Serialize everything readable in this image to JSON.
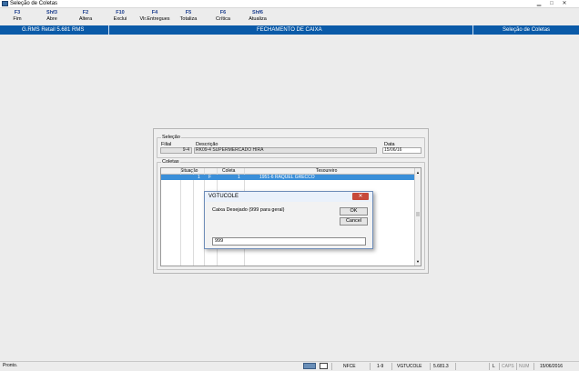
{
  "window": {
    "title": "Seleção de Coletas",
    "controls": [
      "▁",
      "□",
      "✕"
    ]
  },
  "toolbar": [
    {
      "key": "F3",
      "label": "Fim"
    },
    {
      "key": "Shf3",
      "label": "Abre"
    },
    {
      "key": "F2",
      "label": "Altera"
    },
    {
      "key": "F10",
      "label": "Exclui"
    },
    {
      "key": "F4",
      "label": "Vlr.Entregues"
    },
    {
      "key": "F5",
      "label": "Totaliza"
    },
    {
      "key": "F6",
      "label": "Crítica"
    },
    {
      "key": "Shf6",
      "label": "Atualiza"
    }
  ],
  "appbar": {
    "product": "G.RMS Retail 5.681 RMS",
    "module": "FECHAMENTO DE CAIXA",
    "screen": "Seleção de Coletas"
  },
  "selecao": {
    "group_label": "Seleção",
    "filial_label": "Filial",
    "filial_value": "9-4",
    "descricao_label": "Descrição",
    "descricao_value": "RK09-4 SUPERMERCADO HIRA",
    "data_label": "Data",
    "data_value": "15/06/16"
  },
  "coletas": {
    "group_label": "Coletas",
    "columns": [
      "Situação",
      "Coleta",
      "Tesoureiro"
    ],
    "rows": [
      {
        "sit1": "1",
        "sit2": "F",
        "coleta": "1",
        "tesoureiro": "1951-6 RAQUEL GRECCO"
      }
    ]
  },
  "dialog": {
    "title": "VGTUCOLE",
    "close": "✕",
    "message": "Caixa Desejado (999 para geral)",
    "ok": "OK",
    "cancel": "Cancel",
    "input_value": "999"
  },
  "status": {
    "text": "Pronto.",
    "panels": [
      "NFCE",
      "1-9",
      "VGTUCOLE",
      "5.681.3",
      "L",
      "CAPS",
      "NUM",
      "15/06/2016"
    ]
  }
}
